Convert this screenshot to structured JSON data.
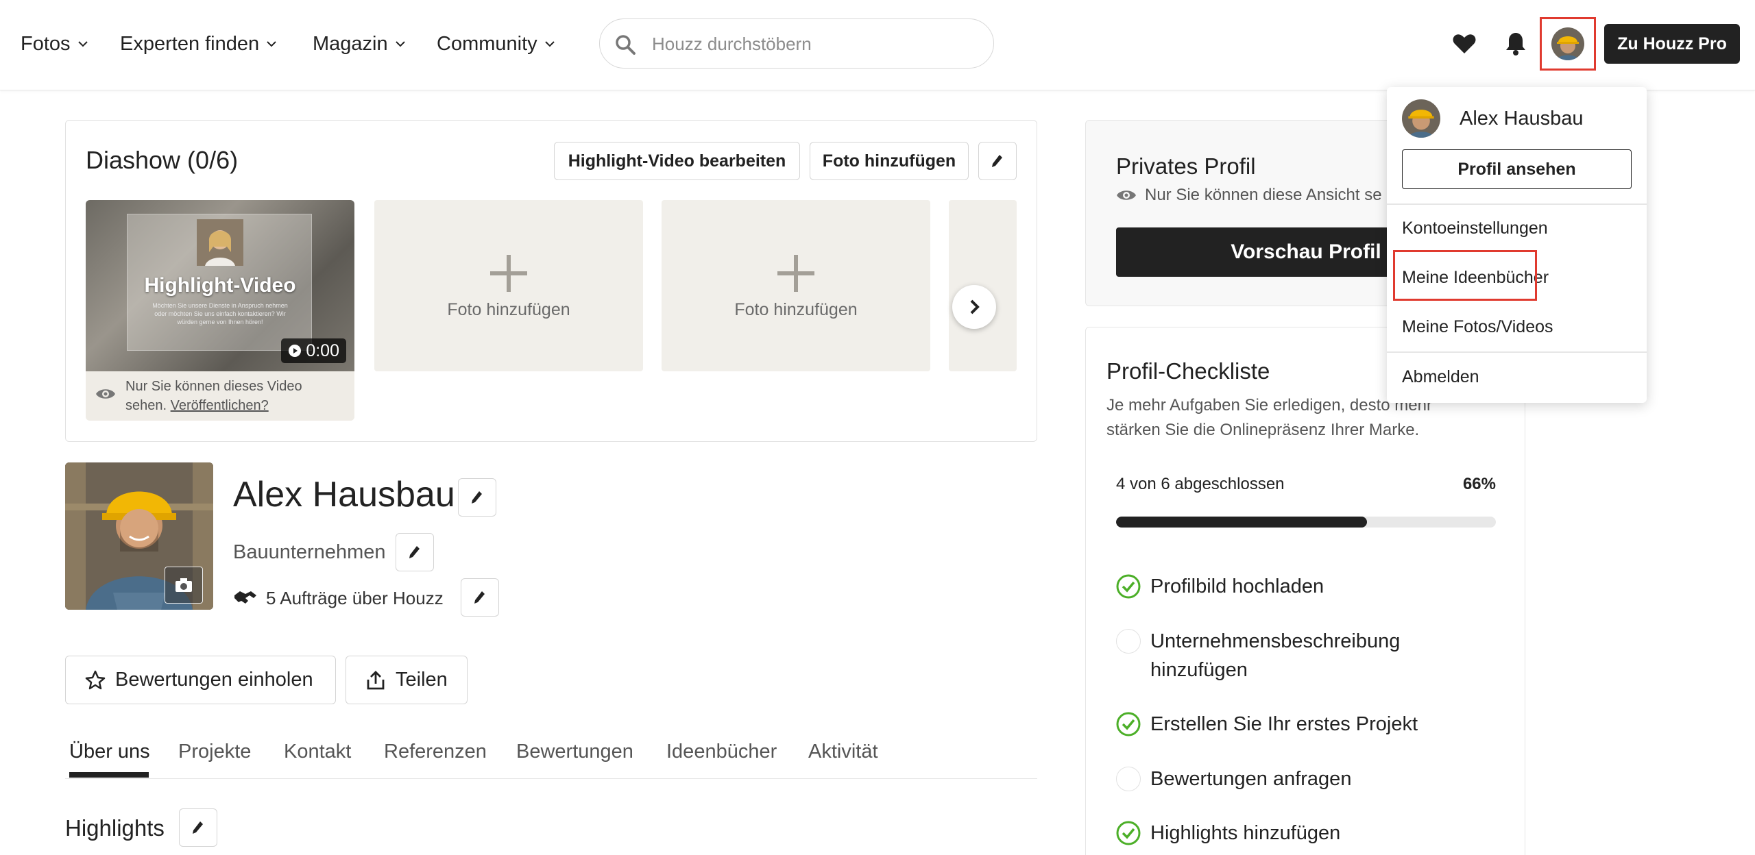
{
  "nav": {
    "items": [
      {
        "label": "Fotos"
      },
      {
        "label": "Experten finden"
      },
      {
        "label": "Magazin"
      },
      {
        "label": "Community"
      }
    ],
    "search_placeholder": "Houzz durchstöbern",
    "pro_button": "Zu Houzz Pro"
  },
  "slideshow": {
    "title": "Diashow (0/6)",
    "edit_video_button": "Highlight-Video bearbeiten",
    "add_photo_button": "Foto hinzufügen",
    "video": {
      "label": "Highlight-Video",
      "sub": "Möchten Sie unsere Dienste in Anspruch nehmen oder möchten Sie uns einfach kontaktieren? Wir würden gerne von Ihnen hören!",
      "duration": "0:00",
      "note": "Nur Sie können dieses Video sehen.",
      "publish_link": "Veröffentlichen?"
    },
    "tiles": [
      {
        "label": "Foto hinzufügen"
      },
      {
        "label": "Foto hinzufügen"
      }
    ]
  },
  "profile": {
    "name": "Alex Hausbau",
    "business_type": "Bauunternehmen",
    "jobs": "5 Aufträge über Houzz",
    "reviews_button": "Bewertungen einholen",
    "share_button": "Teilen"
  },
  "tabs": [
    {
      "label": "Über uns"
    },
    {
      "label": "Projekte"
    },
    {
      "label": "Kontakt"
    },
    {
      "label": "Referenzen"
    },
    {
      "label": "Bewertungen"
    },
    {
      "label": "Ideenbücher"
    },
    {
      "label": "Aktivität"
    }
  ],
  "highlights_title": "Highlights",
  "private_profile": {
    "title": "Privates Profil",
    "note": "Nur Sie können diese Ansicht se",
    "preview_button": "Vorschau Profil"
  },
  "checklist": {
    "title": "Profil-Checkliste",
    "description": "Je mehr Aufgaben Sie erledigen, desto mehr stärken Sie die Onlinepräsenz Ihrer Marke.",
    "progress_text": "4 von 6 abgeschlossen",
    "progress_percent": "66%",
    "progress_value": 0.66,
    "items": [
      {
        "label": "Profilbild hochladen",
        "done": true
      },
      {
        "label": "Unternehmensbeschreibung hinzufügen",
        "done": false
      },
      {
        "label": "Erstellen Sie Ihr erstes Projekt",
        "done": true
      },
      {
        "label": "Bewertungen anfragen",
        "done": false
      },
      {
        "label": "Highlights hinzufügen",
        "done": true
      }
    ]
  },
  "dropdown": {
    "name": "Alex Hausbau",
    "profile_button": "Profil ansehen",
    "items": [
      {
        "label": "Kontoeinstellungen"
      },
      {
        "label": "Meine Ideenbücher"
      },
      {
        "label": "Meine Fotos/Videos"
      },
      {
        "label": "Abmelden"
      }
    ]
  },
  "colors": {
    "accent_dark": "#222222",
    "check_green": "#4caf28",
    "highlight_red": "#e03a2f"
  }
}
